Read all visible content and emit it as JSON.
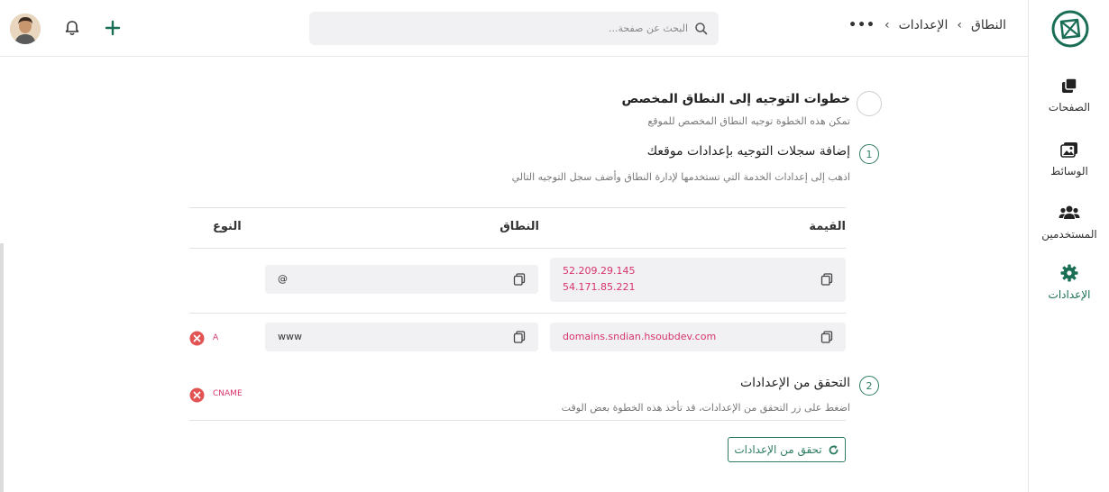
{
  "header": {
    "breadcrumb": {
      "more_label": "•••",
      "items": [
        "الإعدادات",
        "النطاق"
      ]
    },
    "search": {
      "placeholder": "البحث عن صفحة..."
    }
  },
  "sidebar": {
    "items": [
      {
        "label": "الصفحات",
        "icon": "pages-icon"
      },
      {
        "label": "الوسائط",
        "icon": "media-icon"
      },
      {
        "label": "المستخدمين",
        "icon": "users-icon"
      },
      {
        "label": "الإعدادات",
        "icon": "gear-icon",
        "active": true
      }
    ]
  },
  "content": {
    "intro": {
      "title": "خطوات التوجيه إلى النطاق المخصص",
      "subtitle": "تمكن هذه الخطوة توجيه النطاق المخصص للموقع"
    },
    "step1": {
      "number": "1",
      "title": "إضافة سجلات التوجيه بإعدادات موقعك",
      "subtitle": "اذهب إلى إعدادات الخدمة التي تستخدمها لإدارة النطاق وأضف سجل التوجيه التالي"
    },
    "table": {
      "headers": {
        "value": "القيمة",
        "domain": "النطاق",
        "type": "النوع"
      },
      "rows": [
        {
          "value_lines": [
            "52.209.29.145",
            "54.171.85.221"
          ],
          "domain": "@",
          "type": "A"
        },
        {
          "value_lines": [
            "domains.sndian.hsoubdev.com"
          ],
          "domain": "www",
          "type": "CNAME"
        }
      ]
    },
    "step2": {
      "number": "2",
      "title": "التحقق من الإعدادات",
      "subtitle": "اضغط على زر التحقق من الإعدادات، قد تأخذ هذه الخطوة بعض الوقت"
    },
    "verify_button": "تحقق من الإعدادات"
  },
  "colors": {
    "brand": "#1a6e55",
    "accent": "#2e7d62",
    "value_text": "#d6336c",
    "delete": "#e25454"
  }
}
